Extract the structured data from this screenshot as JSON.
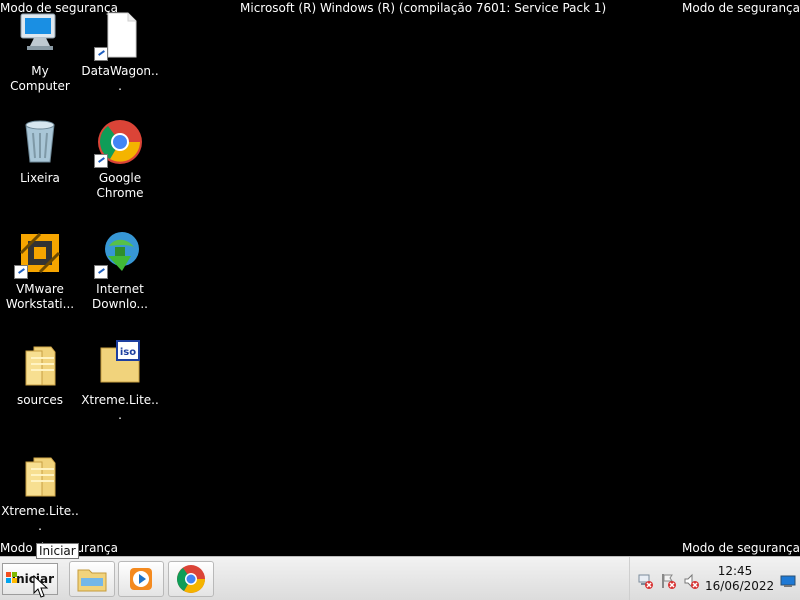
{
  "desktop": {
    "safe_mode_top_left": "Modo de segurança",
    "safe_mode_top_right": "Modo de segurança",
    "safe_mode_bottom_left": "Modo de segurança",
    "safe_mode_bottom_right": "Modo de segurança",
    "title": "Microsoft (R) Windows (R) (compilação 7601: Service Pack 1)",
    "icons": [
      {
        "label": "My Computer",
        "icon": "computer-icon",
        "shortcut": false
      },
      {
        "label": "DataWagon...",
        "icon": "document-icon",
        "shortcut": true
      },
      {
        "label": "Lixeira",
        "icon": "recycle-bin-icon",
        "shortcut": false
      },
      {
        "label": "Google Chrome",
        "icon": "chrome-icon",
        "shortcut": true
      },
      {
        "label": "VMware Workstati...",
        "icon": "vmware-icon",
        "shortcut": true
      },
      {
        "label": "Internet Downlo...",
        "icon": "internet-download-icon",
        "shortcut": true
      },
      {
        "label": "sources",
        "icon": "folder-icon",
        "shortcut": false
      },
      {
        "label": "Xtreme.Lite...",
        "icon": "iso-icon",
        "shortcut": false
      },
      {
        "label": "Xtreme.Lite...",
        "icon": "folder-icon",
        "shortcut": false
      }
    ]
  },
  "taskbar": {
    "start_label": "Iniciar",
    "tooltip": "Iniciar",
    "pinned": [
      {
        "name": "explorer-button",
        "icon": "folder-icon"
      },
      {
        "name": "media-player-button",
        "icon": "media-player-icon"
      },
      {
        "name": "chrome-button",
        "icon": "chrome-icon"
      }
    ],
    "clock_time": "12:45",
    "clock_date": "16/06/2022",
    "tray_icons": [
      "network-error-icon",
      "action-center-error-icon",
      "volume-muted-icon",
      "show-desktop-icon"
    ]
  },
  "colors": {
    "background": "#000000",
    "taskbar": "#e8e8e8",
    "chrome_red": "#db4437",
    "chrome_green": "#0f9d58",
    "chrome_yellow": "#f4b400",
    "chrome_blue": "#4285f4"
  }
}
